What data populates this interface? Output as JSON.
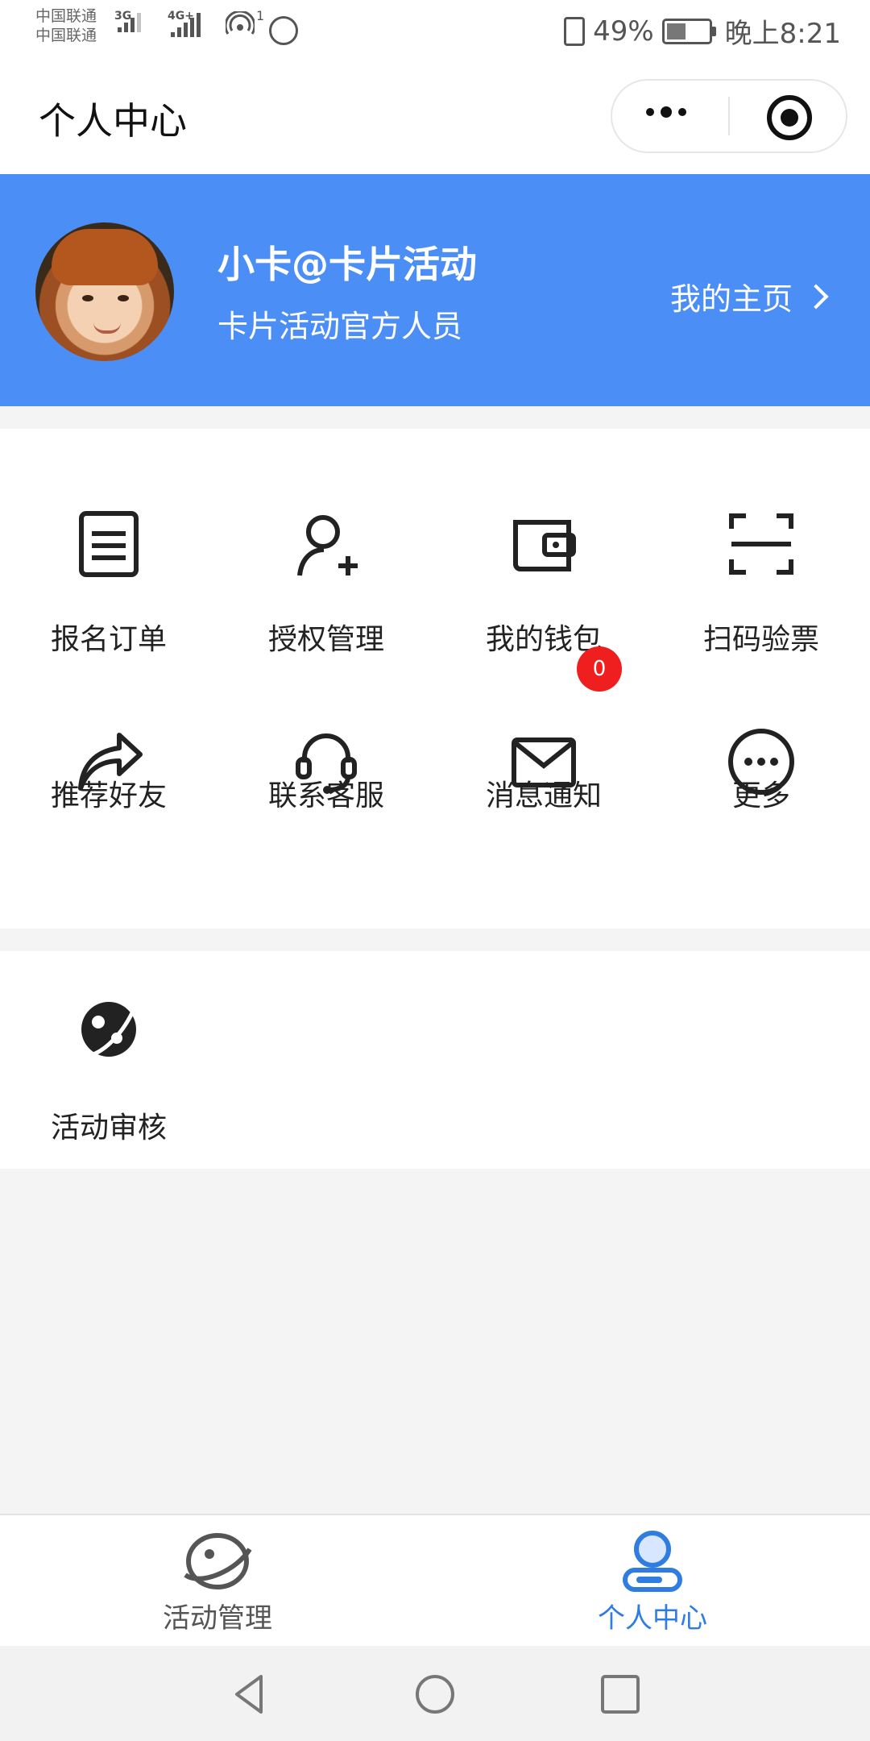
{
  "status_bar": {
    "carrier1": "中国联通",
    "carrier2": "中国联通",
    "network1": "3G",
    "network2": "4G+",
    "hotspot_count": "1",
    "battery_percent": "49%",
    "time": "晚上8:21"
  },
  "nav": {
    "title": "个人中心"
  },
  "profile": {
    "name": "小卡@卡片活动",
    "subtitle": "卡片活动官方人员",
    "homepage_link": "我的主页"
  },
  "grid": {
    "items": [
      {
        "label": "报名订单",
        "icon": "order-icon"
      },
      {
        "label": "授权管理",
        "icon": "user-add-icon"
      },
      {
        "label": "我的钱包",
        "icon": "wallet-icon"
      },
      {
        "label": "扫码验票",
        "icon": "scan-icon"
      },
      {
        "label": "推荐好友",
        "icon": "share-icon"
      },
      {
        "label": "联系客服",
        "icon": "headset-icon"
      },
      {
        "label": "消息通知",
        "icon": "mail-icon",
        "badge": "0"
      },
      {
        "label": "更多",
        "icon": "more-icon"
      }
    ]
  },
  "extra": {
    "items": [
      {
        "label": "活动审核",
        "icon": "planet-review-icon"
      }
    ]
  },
  "tabbar": {
    "left": "活动管理",
    "right": "个人中心"
  },
  "colors": {
    "brand_blue": "#4b8ef6",
    "active_tab": "#2f7de1",
    "badge_red": "#ef1f1f"
  }
}
